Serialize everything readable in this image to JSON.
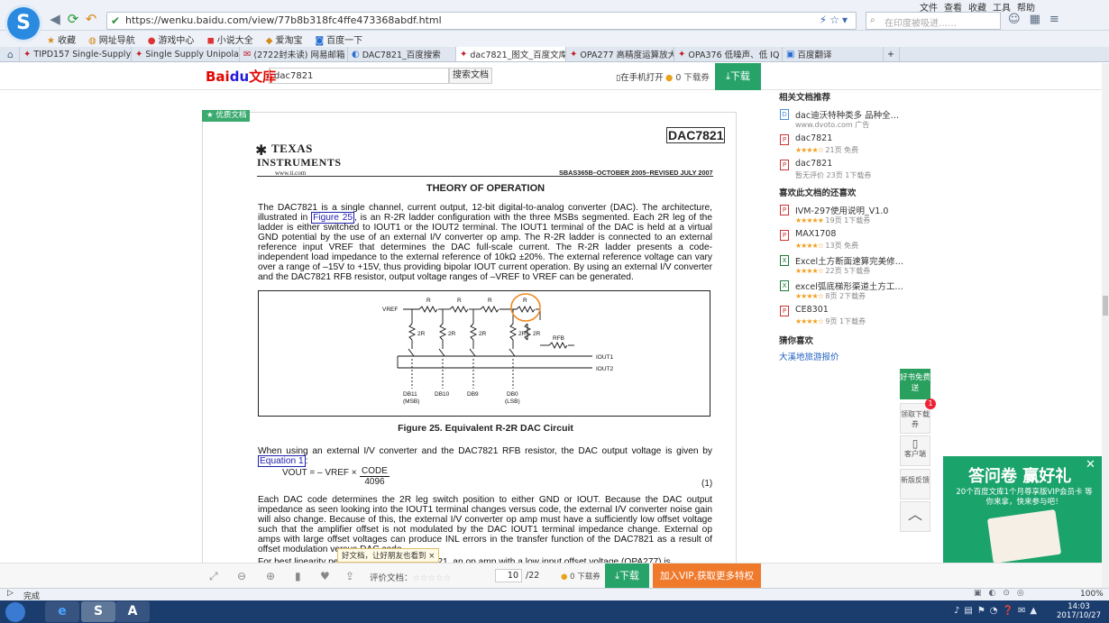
{
  "browser": {
    "url": "https://wenku.baidu.com/view/77b8b318fc4ffe473368abdf.html",
    "search_placeholder": "在印度被吸进……",
    "menu": [
      "文件",
      "查看",
      "收藏",
      "工具",
      "帮助"
    ],
    "bookmarks": [
      "收藏",
      "网址导航",
      "游戏中心",
      "小说大全",
      "爱淘宝",
      "百度一下"
    ],
    "tabs": [
      {
        "label": "TIPD157 Single-Supply",
        "active": false
      },
      {
        "label": "Single Supply Unipolar",
        "active": false
      },
      {
        "label": "(2722封未读) 网易邮箱",
        "active": false
      },
      {
        "label": "DAC7821_百度搜索",
        "active": false
      },
      {
        "label": "dac7821_图文_百度文库",
        "active": true
      },
      {
        "label": "OPA277 高精度运算放大",
        "active": false
      },
      {
        "label": "OPA376 低噪声、低 IQ",
        "active": false
      },
      {
        "label": "百度翻译",
        "active": false
      }
    ],
    "status": "完成",
    "zoom": "100%"
  },
  "wenku": {
    "logo_text": "Bai",
    "logo_paw": "du",
    "logo_suffix": "文库",
    "search_value": "dac7821",
    "search_button": "搜索文档",
    "mobile_open": "在手机打开",
    "coins": "0 下载券",
    "download": "下载",
    "quality_tag": "★ 优质文档"
  },
  "doc": {
    "ti_line1": "TEXAS",
    "ti_line2": "INSTRUMENTS",
    "ti_url": "www.ti.com",
    "title": "DAC7821",
    "revision": "SBAS365B–OCTOBER 2005–REVISED JULY 2007",
    "section": "THEORY OF OPERATION",
    "para1_a": "The DAC7821 is a single channel, current output, 12-bit digital-to-analog converter (DAC). The architecture, illustrated in ",
    "para1_link": "Figure 25",
    "para1_b": ", is an R-2R ladder configuration with the three MSBs segmented. Each 2R leg of the ladder is either switched to IOUT1 or the IOUT2 terminal. The IOUT1 terminal of the DAC is held at a virtual GND potential by the use of an external I/V converter op amp. The R-2R ladder is connected to an external reference input VREF that determines the DAC full-scale current. The R-2R ladder presents a code-independent load impedance to the external reference of 10kΩ ±20%. The external reference voltage can vary over a range of –15V to +15V, thus providing bipolar IOUT current operation. By using an external I/V converter and the DAC7821 RFB resistor, output voltage ranges of –VREF to VREF can be generated.",
    "figure_caption": "Figure 25. Equivalent R-2R DAC Circuit",
    "para2_a": "When using an external I/V converter and the DAC7821 RFB resistor, the DAC output voltage is given by ",
    "para2_link": "Equation 1",
    "para2_b": ":",
    "eq_lhs": "VOUT = – VREF ×",
    "eq_num": "CODE",
    "eq_den": "4096",
    "eq_no": "(1)",
    "para3": "Each DAC code determines the 2R leg switch position to either GND or IOUT. Because the DAC output impedance as seen looking into the IOUT1 terminal changes versus code, the external I/V converter noise gain will also change. Because of this, the external I/V converter op amp must have a sufficiently low offset voltage such that the amplifier offset is not modulated by the DAC IOUT1 terminal impedance change. External op amps with large offset voltages can produce INL errors in the transfer function of the DAC7821 as a result of offset modulation versus DAC code.",
    "para4": "For best linearity performance of the DAC7821, an op amp with a low input offset voltage (OPA277) is…",
    "circuit": {
      "vref": "VREF",
      "r": "R",
      "two_r": "2R",
      "rfb": "RFB",
      "iout1": "IOUT1",
      "iout2": "IOUT2",
      "bits": [
        "DB11",
        "DB10",
        "DB9",
        "DB0"
      ],
      "msb": "(MSB)",
      "lsb": "(LSB)"
    }
  },
  "sidebar": {
    "related_title": "相关文档推荐",
    "related": [
      {
        "name": "dac迪沃特种类多 品种全…",
        "meta": "www.dvoto.com  广告",
        "icon": "dv",
        "stars": ""
      },
      {
        "name": "dac7821",
        "meta": "21页  免费",
        "icon": "pdf",
        "stars": "★★★★☆"
      },
      {
        "name": "dac7821",
        "meta": "暂无评价  23页  1下载券",
        "icon": "pdf",
        "stars": ""
      }
    ],
    "also_like_title": "喜欢此文档的还喜欢",
    "also_like": [
      {
        "name": "IVM-297使用说明_V1.0",
        "meta": "19页  1下载券",
        "icon": "pdf",
        "stars": "★★★★★"
      },
      {
        "name": "MAX1708",
        "meta": "13页  免费",
        "icon": "pdf",
        "stars": "★★★★☆"
      },
      {
        "name": "Excel土方断面速算完美修…",
        "meta": "22页  5下载券",
        "icon": "x",
        "stars": "★★★★☆"
      },
      {
        "name": "excel弧底梯形渠道土方工…",
        "meta": "8页  2下载券",
        "icon": "x",
        "stars": "★★★★☆"
      },
      {
        "name": "CE8301",
        "meta": "9页  1下载券",
        "icon": "pdf",
        "stars": "★★★★☆"
      }
    ],
    "guess_title": "猜你喜欢",
    "guess_link": "大溪地旅游报价"
  },
  "floating": {
    "gift": "好书免费送",
    "coupon": "领取下载券",
    "coupon_badge": "1",
    "client": "客户端",
    "feedback": "新版反馈"
  },
  "ad": {
    "title": "答问卷 赢好礼",
    "subtitle": "20个百度文库1个月尊享版VIP会员卡 等你来拿，快来参与吧！"
  },
  "bottom": {
    "rate_label": "评价文档：",
    "rate_stars": "☆☆☆☆☆",
    "page_current": "10",
    "page_total": "/22",
    "coins": "0 下载券",
    "download": "下载",
    "vip": "加入VIP,获取更多特权",
    "tooltip": "好文档，让好朋友也看到 ×"
  },
  "taskbar": {
    "time": "14:03",
    "date": "2017/10/27"
  }
}
